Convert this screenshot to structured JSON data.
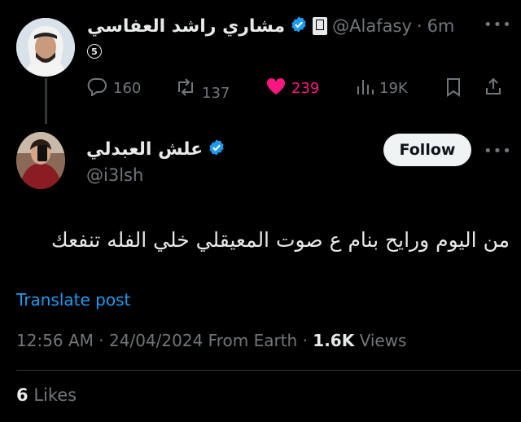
{
  "parent": {
    "display_name": "مشاري راشد العفاسي",
    "handle": "@Alafasy",
    "separator": "·",
    "time": "6m",
    "badge_number": "5",
    "stats": {
      "replies": "160",
      "reposts": "137",
      "likes": "239",
      "views": "19K"
    }
  },
  "reply": {
    "display_name": "علش العبدلي",
    "handle": "@i3lsh",
    "follow_label": "Follow",
    "text": "من اليوم ورايح بنام ع صوت المعيقلي خلي الفله تنفعك",
    "translate_label": "Translate post",
    "time": "12:56 AM",
    "date": "24/04/2024",
    "location": "From Earth",
    "views_count": "1.6K",
    "views_label": "Views",
    "likes_count": "6",
    "likes_label": "Likes"
  },
  "colors": {
    "background": "#000000",
    "text": "#e7e9ea",
    "muted": "#71767b",
    "verified": "#1d9bf0",
    "like": "#f91880",
    "link": "#1d9bf0"
  },
  "icons": [
    "more-icon",
    "verified-icon",
    "affiliate-badge-icon",
    "reply-icon",
    "repost-icon",
    "like-icon",
    "views-icon",
    "bookmark-icon",
    "share-icon"
  ]
}
